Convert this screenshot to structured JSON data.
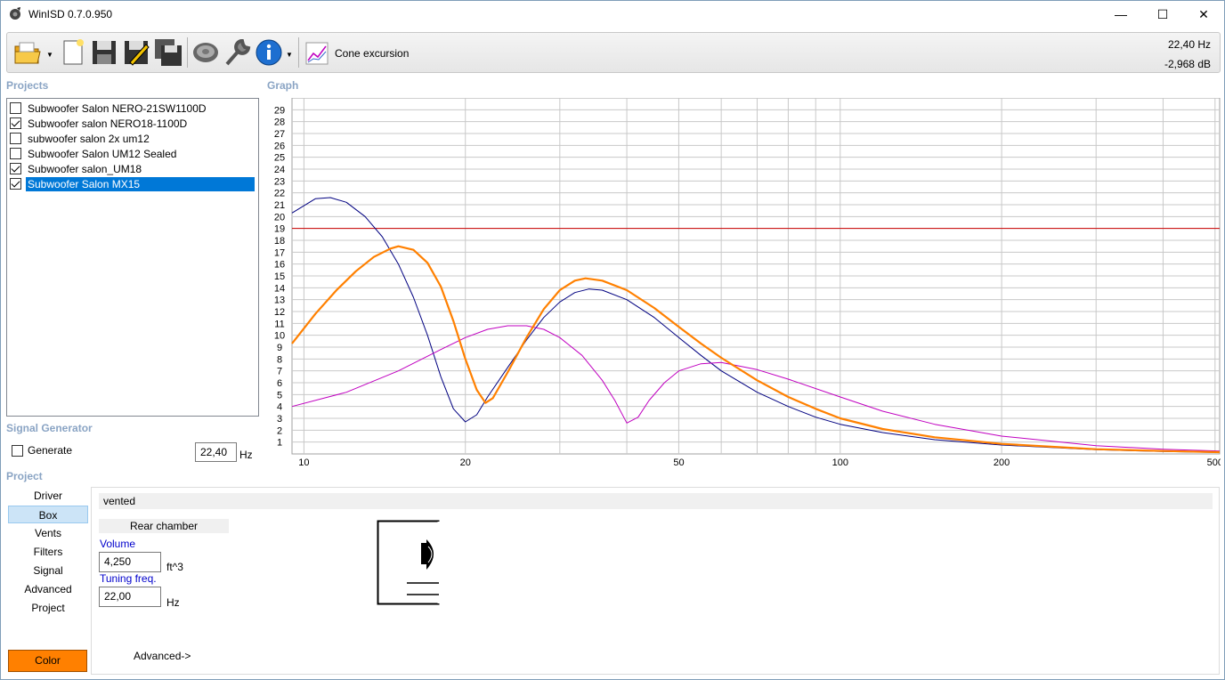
{
  "window": {
    "title": "WinISD 0.7.0.950",
    "minimize": "—",
    "maximize": "☐",
    "close": "✕"
  },
  "toolbar": {
    "cone_label": "Cone excursion",
    "freq_readout": "22,40 Hz",
    "db_readout": "-2,968 dB",
    "icons": [
      "open-folder-icon",
      "new-document-icon",
      "save-icon",
      "edit-save-icon",
      "save-as-icon",
      "driver-icon",
      "wrench-icon",
      "info-icon",
      "graph-icon"
    ]
  },
  "projects": {
    "label": "Projects",
    "items": [
      {
        "name": "Subwoofer Salon NERO-21SW1100D",
        "checked": false,
        "selected": false
      },
      {
        "name": "Subwoofer salon NERO18-1100D",
        "checked": true,
        "selected": false
      },
      {
        "name": "subwoofer salon 2x um12",
        "checked": false,
        "selected": false
      },
      {
        "name": "Subwoofer Salon UM12 Sealed",
        "checked": false,
        "selected": false
      },
      {
        "name": "Subwoofer salon_UM18",
        "checked": true,
        "selected": false
      },
      {
        "name": "Subwoofer Salon MX15",
        "checked": true,
        "selected": true
      }
    ]
  },
  "graph_label": "Graph",
  "signal": {
    "label": "Signal Generator",
    "generate_label": "Generate",
    "generate_checked": false,
    "freq_value": "22,40",
    "freq_unit": "Hz"
  },
  "project_section": {
    "label": "Project",
    "nav": [
      "Driver",
      "Box",
      "Vents",
      "Filters",
      "Signal",
      "Advanced",
      "Project"
    ],
    "active_nav": "Box",
    "color_button": "Color",
    "box_type": "vented",
    "rear_chamber": "Rear chamber",
    "volume_label": "Volume",
    "volume_value": "4,250",
    "volume_unit": "ft^3",
    "tuning_label": "Tuning freq.",
    "tuning_value": "22,00",
    "tuning_unit": "Hz",
    "advanced_link": "Advanced->"
  },
  "chart_data": {
    "type": "line",
    "x_scale": "log",
    "xlim": [
      9.5,
      510
    ],
    "ylim": [
      0,
      30
    ],
    "x_ticks": [
      10,
      20,
      50,
      100,
      200,
      500
    ],
    "y_ticks": [
      1,
      2,
      3,
      4,
      5,
      6,
      7,
      8,
      9,
      10,
      11,
      12,
      13,
      14,
      15,
      16,
      17,
      18,
      19,
      20,
      21,
      22,
      23,
      24,
      25,
      26,
      27,
      28,
      29
    ],
    "limit_line": {
      "y": 19,
      "color": "#cc0000"
    },
    "series": [
      {
        "color": "#000080",
        "width": 1,
        "points": [
          [
            9.5,
            20.3
          ],
          [
            10.5,
            21.5
          ],
          [
            11.2,
            21.6
          ],
          [
            12,
            21.2
          ],
          [
            13,
            20
          ],
          [
            14,
            18.3
          ],
          [
            15,
            16
          ],
          [
            16,
            13.2
          ],
          [
            17,
            10
          ],
          [
            18,
            6.5
          ],
          [
            19,
            3.8
          ],
          [
            20,
            2.7
          ],
          [
            21,
            3.3
          ],
          [
            22,
            4.8
          ],
          [
            24,
            7.3
          ],
          [
            26,
            9.6
          ],
          [
            28,
            11.5
          ],
          [
            30,
            12.8
          ],
          [
            32,
            13.6
          ],
          [
            34,
            13.9
          ],
          [
            36,
            13.8
          ],
          [
            40,
            13.0
          ],
          [
            45,
            11.5
          ],
          [
            50,
            9.8
          ],
          [
            55,
            8.3
          ],
          [
            60,
            7.0
          ],
          [
            70,
            5.2
          ],
          [
            80,
            4.0
          ],
          [
            90,
            3.1
          ],
          [
            100,
            2.5
          ],
          [
            120,
            1.8
          ],
          [
            150,
            1.2
          ],
          [
            200,
            0.75
          ],
          [
            300,
            0.35
          ],
          [
            400,
            0.2
          ],
          [
            510,
            0.12
          ]
        ]
      },
      {
        "color": "#c000c0",
        "width": 1,
        "points": [
          [
            9.5,
            4.0
          ],
          [
            12,
            5.2
          ],
          [
            15,
            7.0
          ],
          [
            18,
            8.8
          ],
          [
            20,
            9.8
          ],
          [
            22,
            10.5
          ],
          [
            24,
            10.8
          ],
          [
            26,
            10.8
          ],
          [
            28,
            10.5
          ],
          [
            30,
            9.8
          ],
          [
            33,
            8.3
          ],
          [
            36,
            6.2
          ],
          [
            38,
            4.5
          ],
          [
            40,
            2.6
          ],
          [
            42,
            3.1
          ],
          [
            44,
            4.5
          ],
          [
            47,
            6.0
          ],
          [
            50,
            7.0
          ],
          [
            55,
            7.6
          ],
          [
            60,
            7.7
          ],
          [
            70,
            7.1
          ],
          [
            80,
            6.3
          ],
          [
            100,
            4.8
          ],
          [
            120,
            3.6
          ],
          [
            150,
            2.5
          ],
          [
            200,
            1.5
          ],
          [
            300,
            0.7
          ],
          [
            400,
            0.4
          ],
          [
            510,
            0.25
          ]
        ]
      },
      {
        "color": "#ff8000",
        "width": 2.2,
        "points": [
          [
            9.5,
            9.3
          ],
          [
            10.5,
            11.8
          ],
          [
            11.5,
            13.8
          ],
          [
            12.5,
            15.4
          ],
          [
            13.5,
            16.6
          ],
          [
            14.5,
            17.3
          ],
          [
            15,
            17.5
          ],
          [
            16,
            17.2
          ],
          [
            17,
            16.1
          ],
          [
            18,
            14.1
          ],
          [
            19,
            11.2
          ],
          [
            20,
            8.0
          ],
          [
            21,
            5.4
          ],
          [
            21.8,
            4.3
          ],
          [
            22.5,
            4.7
          ],
          [
            24,
            6.9
          ],
          [
            26,
            9.8
          ],
          [
            28,
            12.2
          ],
          [
            30,
            13.8
          ],
          [
            32,
            14.6
          ],
          [
            33.5,
            14.8
          ],
          [
            36,
            14.6
          ],
          [
            40,
            13.8
          ],
          [
            45,
            12.3
          ],
          [
            50,
            10.7
          ],
          [
            55,
            9.3
          ],
          [
            60,
            8.1
          ],
          [
            70,
            6.2
          ],
          [
            80,
            4.8
          ],
          [
            90,
            3.8
          ],
          [
            100,
            3.0
          ],
          [
            120,
            2.1
          ],
          [
            150,
            1.4
          ],
          [
            200,
            0.85
          ],
          [
            300,
            0.4
          ],
          [
            400,
            0.25
          ],
          [
            510,
            0.15
          ]
        ]
      }
    ]
  }
}
